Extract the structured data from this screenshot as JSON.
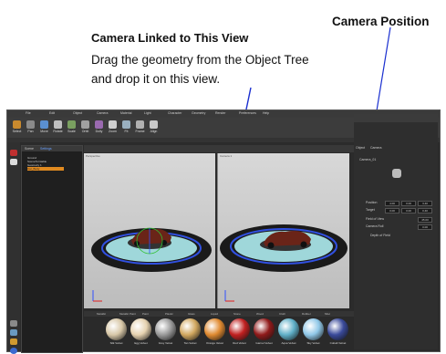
{
  "annotations": {
    "camera_position": "Camera Position",
    "camera_linked": "Camera Linked to This View",
    "instruction_line1": "Drag the geometry from the Object Tree",
    "instruction_line2": "and drop it on this view."
  },
  "menu": [
    "File",
    "Edit",
    "Object",
    "Camera",
    "Material",
    "Light",
    "Character",
    "Geometry",
    "Render",
    "Preferences",
    "Help"
  ],
  "toolbar_buttons": [
    {
      "label": "Select",
      "color": "#c98a2e"
    },
    {
      "label": "Pan",
      "color": "#8a8a8a"
    },
    {
      "label": "Move",
      "color": "#5a8fd0"
    },
    {
      "label": "Rotate",
      "color": "#c0c0c0"
    },
    {
      "label": "Scale",
      "color": "#7aa060"
    },
    {
      "label": "Orbit",
      "color": "#a0a0a0"
    },
    {
      "label": "Dolly",
      "color": "#9a6ab0"
    },
    {
      "label": "Zoom",
      "color": "#d0d0d0"
    },
    {
      "label": "Fit",
      "color": "#9ab0c0"
    },
    {
      "label": "Frame",
      "color": "#b0b0b0"
    },
    {
      "label": "Align",
      "color": "#c8c8c8"
    }
  ],
  "scene_panel": {
    "tabs": [
      "Scene",
      "Settings"
    ],
    "tree": [
      "Ground",
      "SceneTurntable",
      "Geometry 1",
      "Car_Body"
    ]
  },
  "viewports": {
    "left_label": "Perspective",
    "right_label": "Camera 1"
  },
  "right_panel": {
    "tabs": [
      "Object",
      "Camera"
    ],
    "name_label": "Camera_01",
    "position_label": "Position",
    "target_label": "Target",
    "fov_label": "Field of View",
    "roll_label": "Camera Roll",
    "dof_label": "Depth of Field",
    "position": [
      "4.00",
      "0.00",
      "3.40"
    ],
    "target": [
      "0.00",
      "0.00",
      "0.40"
    ],
    "fov": "45.00",
    "roll": "0.00"
  },
  "material_tabs": [
    "Metallic",
    "Metallic Paint",
    "Paint",
    "Plastic",
    "Glass",
    "Liquid",
    "Stone",
    "Wood",
    "Cloth",
    "Rubber",
    "Misc"
  ],
  "materials": [
    {
      "name": "Silk Velvet",
      "color": "#d8c8a8"
    },
    {
      "name": "Egg Velvet",
      "color": "#e6d2b0"
    },
    {
      "name": "Grey Velvet",
      "color": "#9a9a9a"
    },
    {
      "name": "Tan Velvet",
      "color": "#d2a860"
    },
    {
      "name": "Orange Velvet",
      "color": "#e08a30"
    },
    {
      "name": "Red Velvet",
      "color": "#c02020"
    },
    {
      "name": "Garnet Velvet",
      "color": "#901a1a"
    },
    {
      "name": "Aqua Velvet",
      "color": "#60b0c8"
    },
    {
      "name": "Sky Velvet",
      "color": "#90c8e8"
    },
    {
      "name": "Cobalt Velvet",
      "color": "#3a4a9a"
    }
  ]
}
